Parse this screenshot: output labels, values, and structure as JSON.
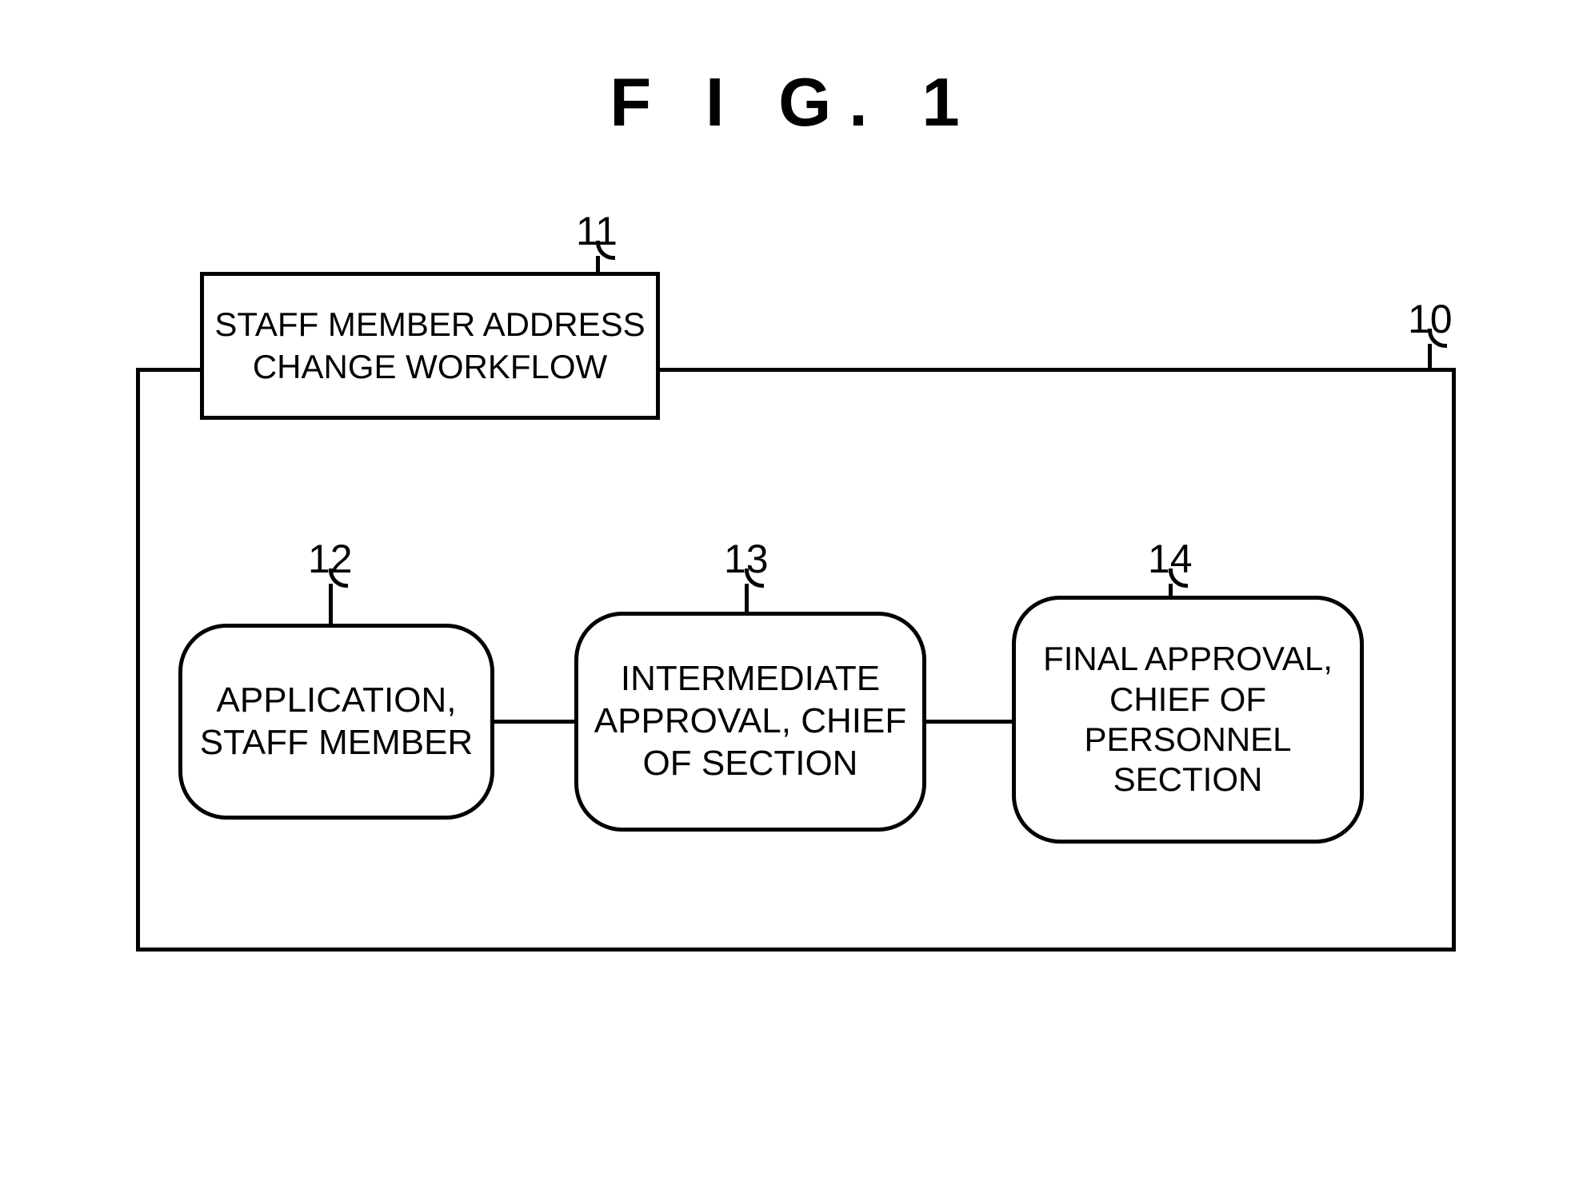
{
  "figure": {
    "title": "F I G.  1"
  },
  "workflow": {
    "title": "STAFF MEMBER ADDRESS CHANGE WORKFLOW",
    "container_ref": "10",
    "title_ref": "11",
    "nodes": [
      {
        "ref": "12",
        "label": "APPLICATION, STAFF MEMBER"
      },
      {
        "ref": "13",
        "label": "INTERMEDIATE APPROVAL, CHIEF OF SECTION"
      },
      {
        "ref": "14",
        "label": "FINAL APPROVAL, CHIEF OF PERSONNEL SECTION"
      }
    ]
  }
}
